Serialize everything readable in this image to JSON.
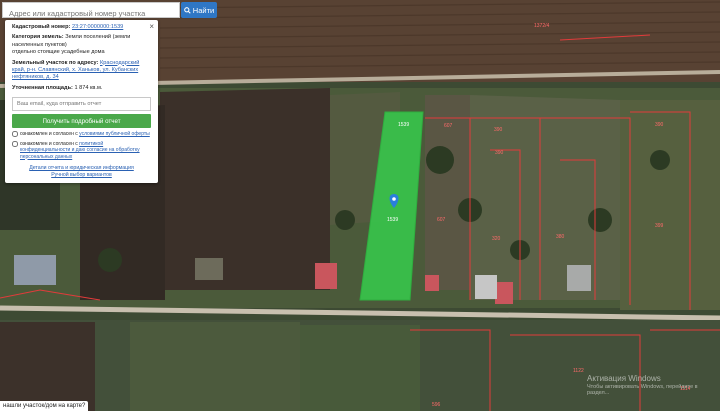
{
  "search": {
    "placeholder": "Адрес или кадастровый номер участка",
    "button": "Найти"
  },
  "card": {
    "cadastral_label": "Кадастровый номер:",
    "cadastral_value": "23:27:0000000:1539",
    "category_label": "Категория земель:",
    "category_value": "Земли поселений (земли населенных пунктов)",
    "usage": "отдельно стоящие усадебные дома",
    "address_label": "Земельный участок по адресу:",
    "address_value": "Краснодарский край, р-н. Славянский, х. Ханьков, ул. Кубанских нефтяников, д. 34",
    "area_label": "Уточненная площадь:",
    "area_value": "1 874 кв.м.",
    "email_placeholder": "Ваш email, куда отправить отчет",
    "report_button": "Получить подробный отчет",
    "consent1_prefix": "ознакомлен и согласен с ",
    "consent1_link": "условиями публичной оферты",
    "consent2_prefix": "ознакомлен и согласен с ",
    "consent2_link": "политикой конфиденциальности и даю согласие на обработку персональных данных",
    "link_details": "Детали отчета и юридическая информация",
    "link_manual": "Ручной выбор вариантов",
    "close": "×"
  },
  "map_labels": {
    "p1539a": "1539",
    "p1539b": "1539",
    "p607a": "607",
    "p607b": "607",
    "p390a": "390",
    "p390b": "390",
    "p390c": "390",
    "p380": "380",
    "p399": "399",
    "p320": "320",
    "p596": "596",
    "p1122": "1122",
    "p1372": "1372/4",
    "p1114": "1114"
  },
  "bottom_question": "нашли участок/дом на карте?",
  "watermark": {
    "line1": "Активация Windows",
    "line2": "Чтобы активировать Windows, перейдите в раздел..."
  }
}
